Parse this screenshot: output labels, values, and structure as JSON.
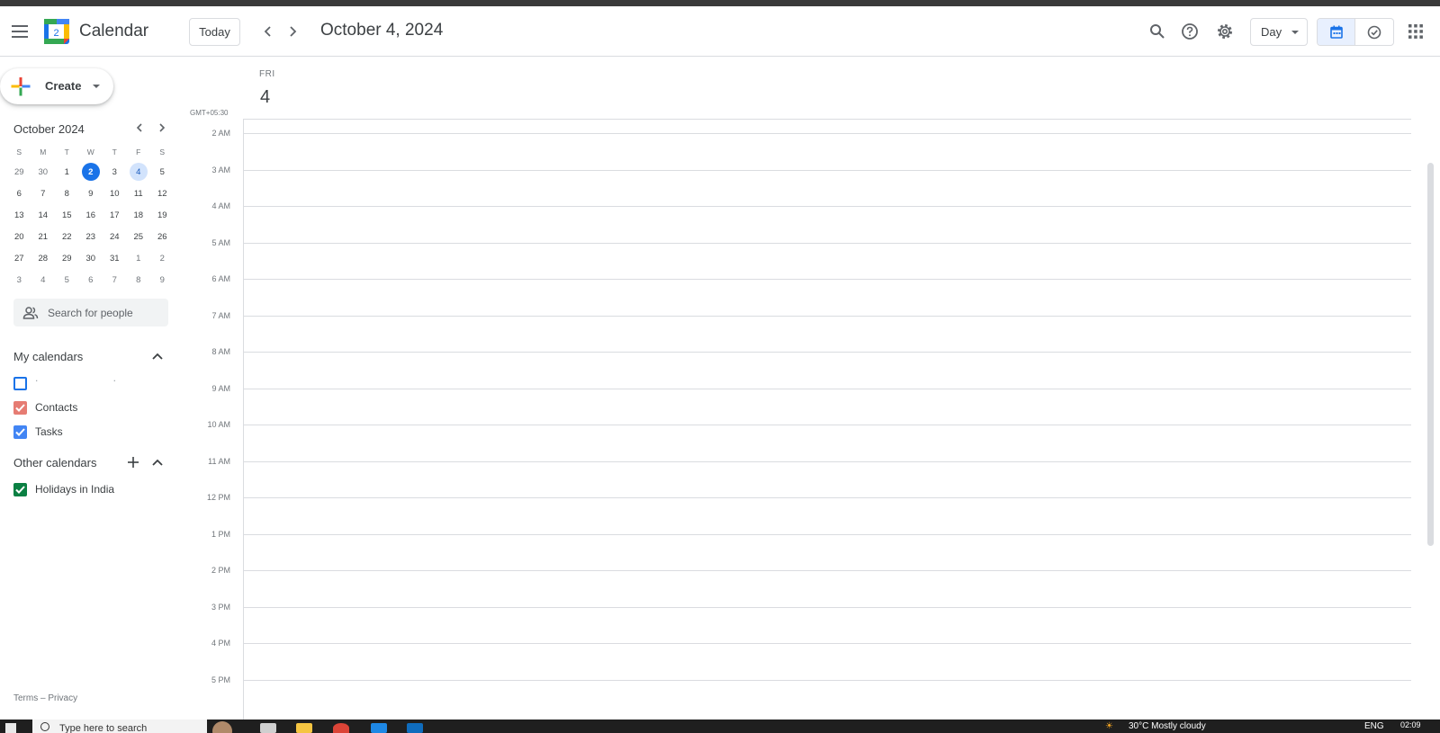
{
  "header": {
    "app_title": "Calendar",
    "logo_day": "2",
    "today_label": "Today",
    "date_title": "October 4, 2024",
    "view_label": "Day",
    "colors": {
      "accent": "#1a73e8",
      "border": "#dadce0",
      "text": "#3c4043"
    }
  },
  "sidebar": {
    "create_label": "Create",
    "mini_calendar": {
      "title": "October 2024",
      "weekdays": [
        "S",
        "M",
        "T",
        "W",
        "T",
        "F",
        "S"
      ],
      "weeks": [
        [
          "29",
          "30",
          "1",
          "2",
          "3",
          "4",
          "5"
        ],
        [
          "6",
          "7",
          "8",
          "9",
          "10",
          "11",
          "12"
        ],
        [
          "13",
          "14",
          "15",
          "16",
          "17",
          "18",
          "19"
        ],
        [
          "20",
          "21",
          "22",
          "23",
          "24",
          "25",
          "26"
        ],
        [
          "27",
          "28",
          "29",
          "30",
          "31",
          "1",
          "2"
        ],
        [
          "3",
          "4",
          "5",
          "6",
          "7",
          "8",
          "9"
        ]
      ],
      "today": "2",
      "selected": "4"
    },
    "people_search_placeholder": "Search for people",
    "my_calendars": {
      "title": "My calendars",
      "items": [
        {
          "label": ". .",
          "checked": false,
          "color": "#1a73e8"
        },
        {
          "label": "Contacts",
          "checked": true,
          "color": "#e67c73"
        },
        {
          "label": "Tasks",
          "checked": true,
          "color": "#4285f4"
        }
      ]
    },
    "other_calendars": {
      "title": "Other calendars",
      "items": [
        {
          "label": "Holidays in India",
          "checked": true,
          "color": "#0b8043"
        }
      ]
    },
    "footer": "Terms – Privacy"
  },
  "day_view": {
    "day_of_week": "FRI",
    "day_number": "4",
    "timezone": "GMT+05:30",
    "hours": [
      "2 AM",
      "3 AM",
      "4 AM",
      "5 AM",
      "6 AM",
      "7 AM",
      "8 AM",
      "9 AM",
      "10 AM",
      "11 AM",
      "12 PM",
      "1 PM",
      "2 PM",
      "3 PM",
      "4 PM",
      "5 PM"
    ]
  },
  "taskbar": {
    "search_text": "Type here to search",
    "weather_text": "30°C Mostly cloudy",
    "language": "ENG",
    "time": "02:09"
  }
}
